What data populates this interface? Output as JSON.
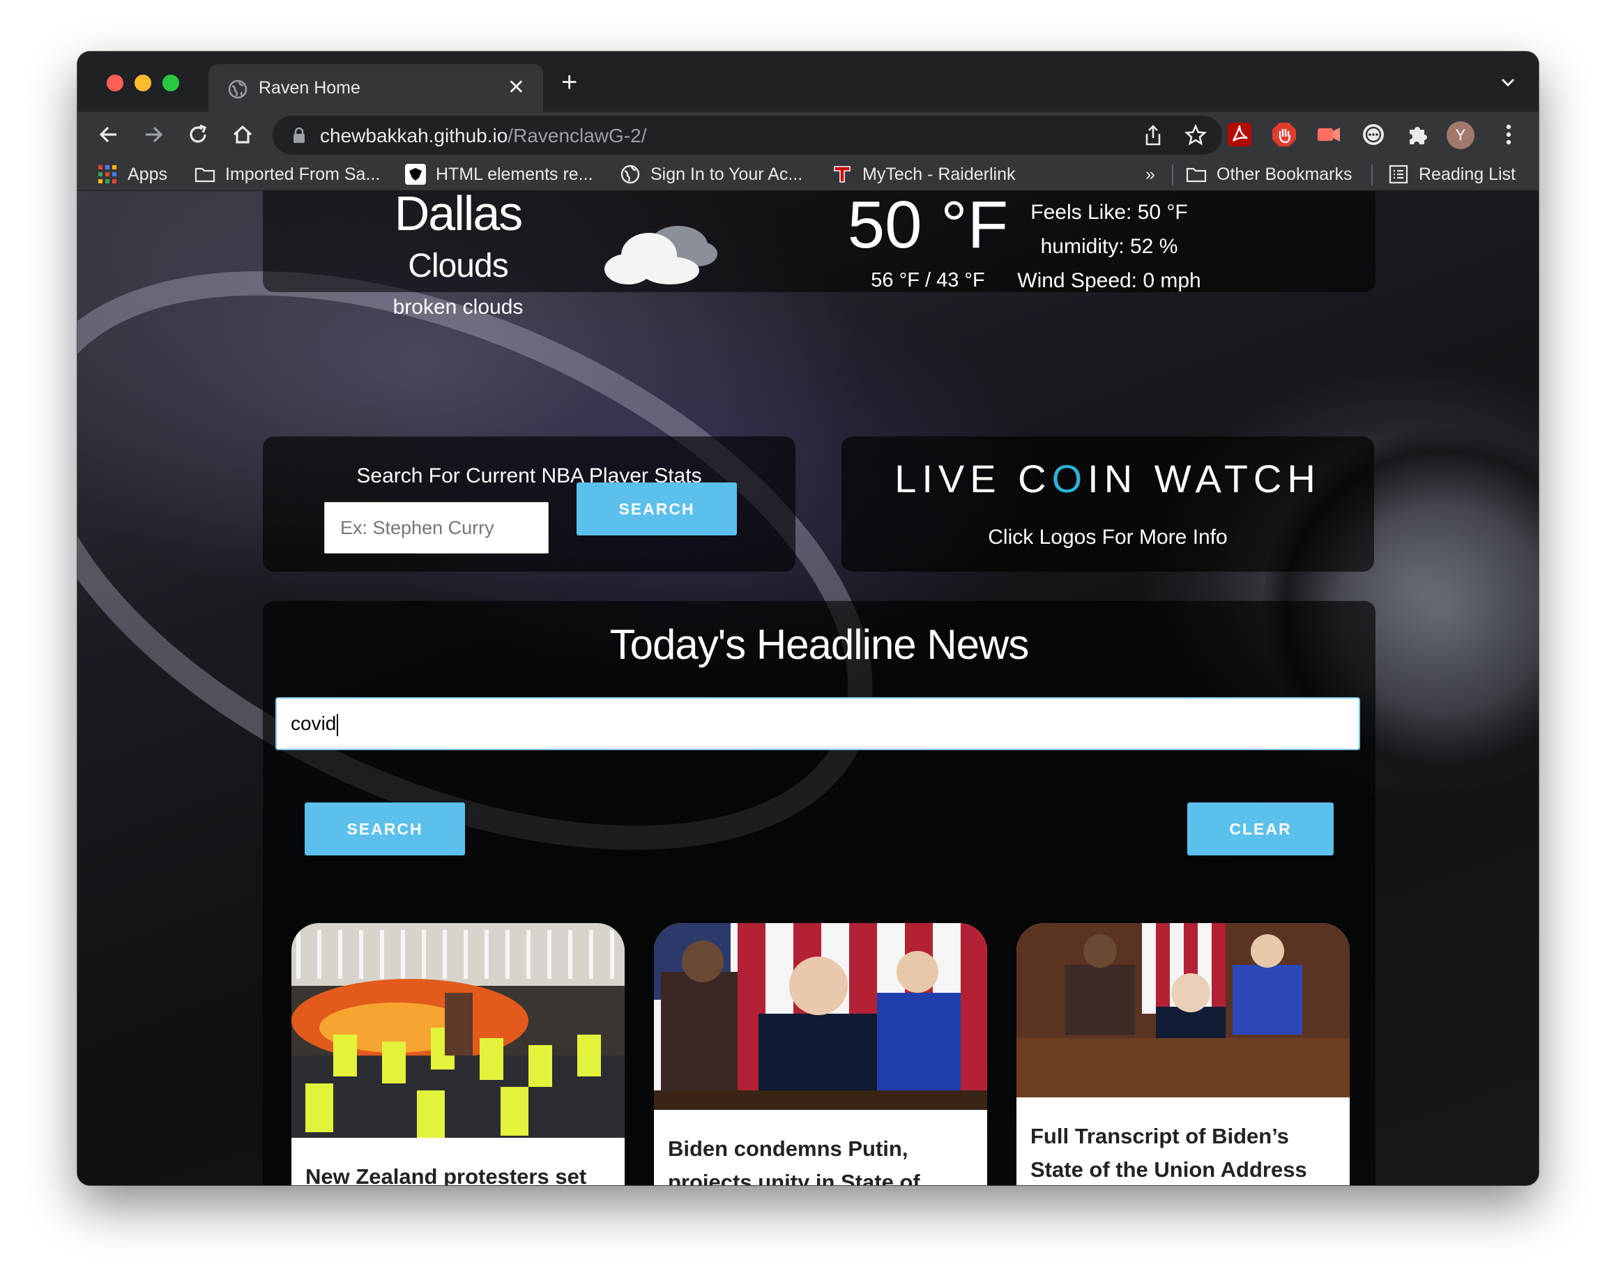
{
  "browser": {
    "tab_title": "Raven Home",
    "tab_close": "✕",
    "new_tab": "+",
    "url_host": "chewbakkah.github.io",
    "url_path": "/RavenclawG-2/",
    "avatar_initial": "Y"
  },
  "bookmarks": [
    {
      "label": "Apps",
      "icon": "apps-grid-icon"
    },
    {
      "label": "Imported From Sa...",
      "icon": "folder-icon"
    },
    {
      "label": "HTML elements re...",
      "icon": "mdn-icon"
    },
    {
      "label": "Sign In to Your Ac...",
      "icon": "globe-icon"
    },
    {
      "label": "MyTech - Raiderlink",
      "icon": "texas-tech-icon"
    }
  ],
  "bookmarks_overflow": "»",
  "bookmarks_right": {
    "other": "Other Bookmarks",
    "reading_list": "Reading List"
  },
  "weather": {
    "city": "Dallas",
    "main": "Clouds",
    "description": "broken clouds",
    "icon": "broken-clouds-icon",
    "temp": "50 °F",
    "range": "56 °F / 43 °F",
    "feels_like": "Feels Like: 50 °F",
    "humidity": "humidity: 52 %",
    "wind": "Wind Speed: 0 mph"
  },
  "nba": {
    "title": "Search For Current NBA Player Stats",
    "placeholder": "Ex: Stephen Curry",
    "button": "SEARCH"
  },
  "coin": {
    "logo_left": "LIVE C",
    "logo_o": "O",
    "logo_right": "IN WATCH",
    "subtitle": "Click Logos For More Info"
  },
  "news": {
    "title": "Today's Headline News",
    "query": "covid",
    "search_button": "SEARCH",
    "clear_button": "CLEAR",
    "articles": [
      {
        "headline": "New Zealand protesters set fires as police break"
      },
      {
        "headline": "Biden condemns Putin, projects unity in State of Union address"
      },
      {
        "headline": "Full Transcript of Biden’s State of the Union Address"
      }
    ]
  },
  "colors": {
    "accent": "#5bc0eb",
    "chrome_dark": "#202124",
    "chrome_toolbar": "#35363a"
  }
}
